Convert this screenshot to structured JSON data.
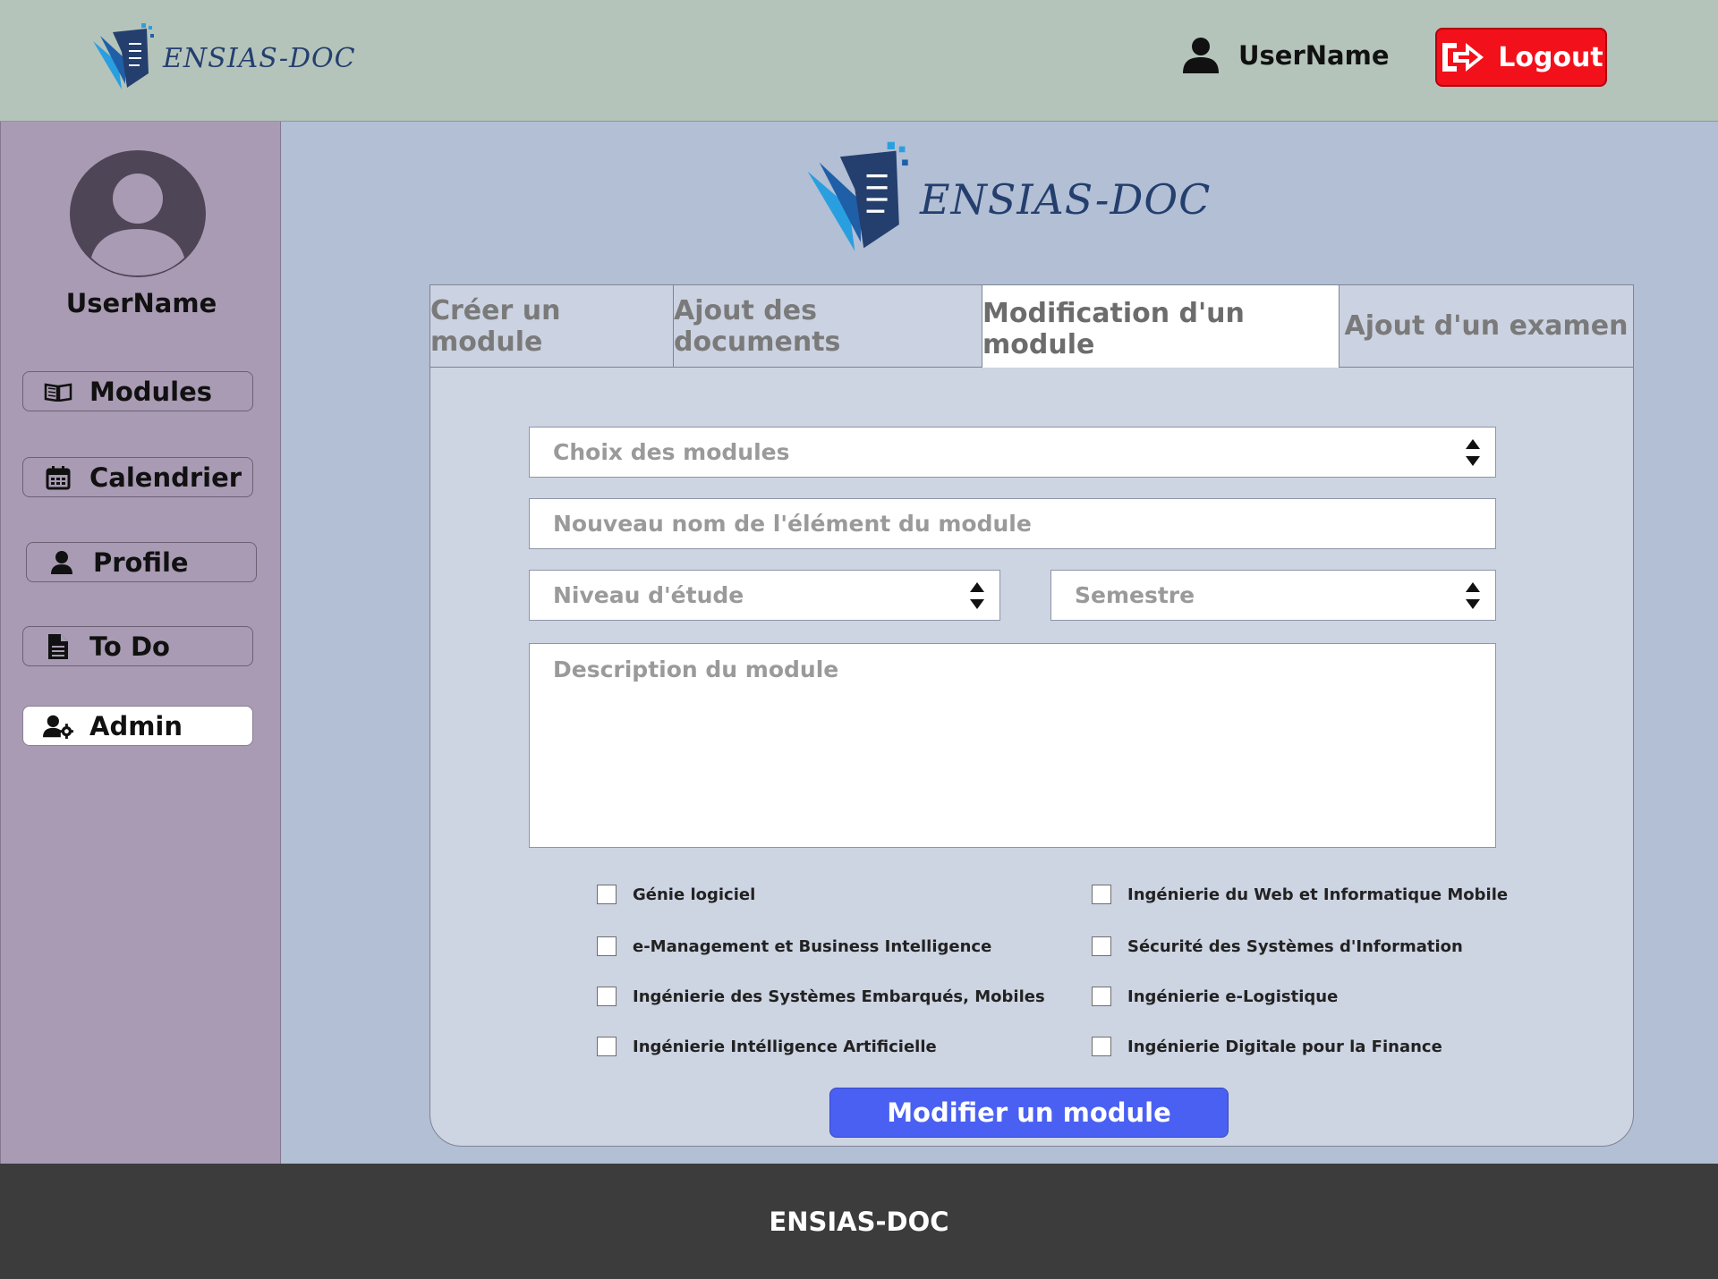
{
  "header": {
    "logo_text": "ENSIAS-DOC",
    "username": "UserName",
    "logout_label": "Logout",
    "logout_color": "#f2101a"
  },
  "sidebar": {
    "username": "UserName",
    "items": [
      {
        "label": "Modules",
        "icon": "book-open-icon",
        "active": false
      },
      {
        "label": "Calendrier",
        "icon": "calendar-icon",
        "active": false
      },
      {
        "label": "Profile",
        "icon": "user-icon",
        "active": false
      },
      {
        "label": "To Do",
        "icon": "file-icon",
        "active": false
      },
      {
        "label": "Admin",
        "icon": "user-cog-icon",
        "active": true
      }
    ]
  },
  "main": {
    "logo_text": "ENSIAS-DOC",
    "tabs": [
      {
        "label": "Créer un module",
        "active": false
      },
      {
        "label": "Ajout des documents",
        "active": false
      },
      {
        "label": "Modification d'un module",
        "active": true
      },
      {
        "label": "Ajout d'un examen",
        "active": false
      }
    ],
    "form": {
      "module_select_placeholder": "Choix des modules",
      "new_name_placeholder": "Nouveau nom de l'élément du module",
      "level_select_placeholder": "Niveau d'étude",
      "semester_select_placeholder": "Semestre",
      "description_placeholder": "Description du module",
      "filieres": [
        "Génie logiciel",
        "Ingénierie du Web et Informatique Mobile",
        "e-Management et Business Intelligence",
        "Sécurité des Systèmes d'Information",
        "Ingénierie des Systèmes Embarqués, Mobiles",
        "Ingénierie e-Logistique",
        "Ingénierie Intélligence Artificielle",
        "Ingénierie Digitale pour la Finance"
      ],
      "submit_label": "Modifier un module",
      "submit_color": "#4a60f2"
    }
  },
  "footer": {
    "text": "ENSIAS-DOC"
  }
}
